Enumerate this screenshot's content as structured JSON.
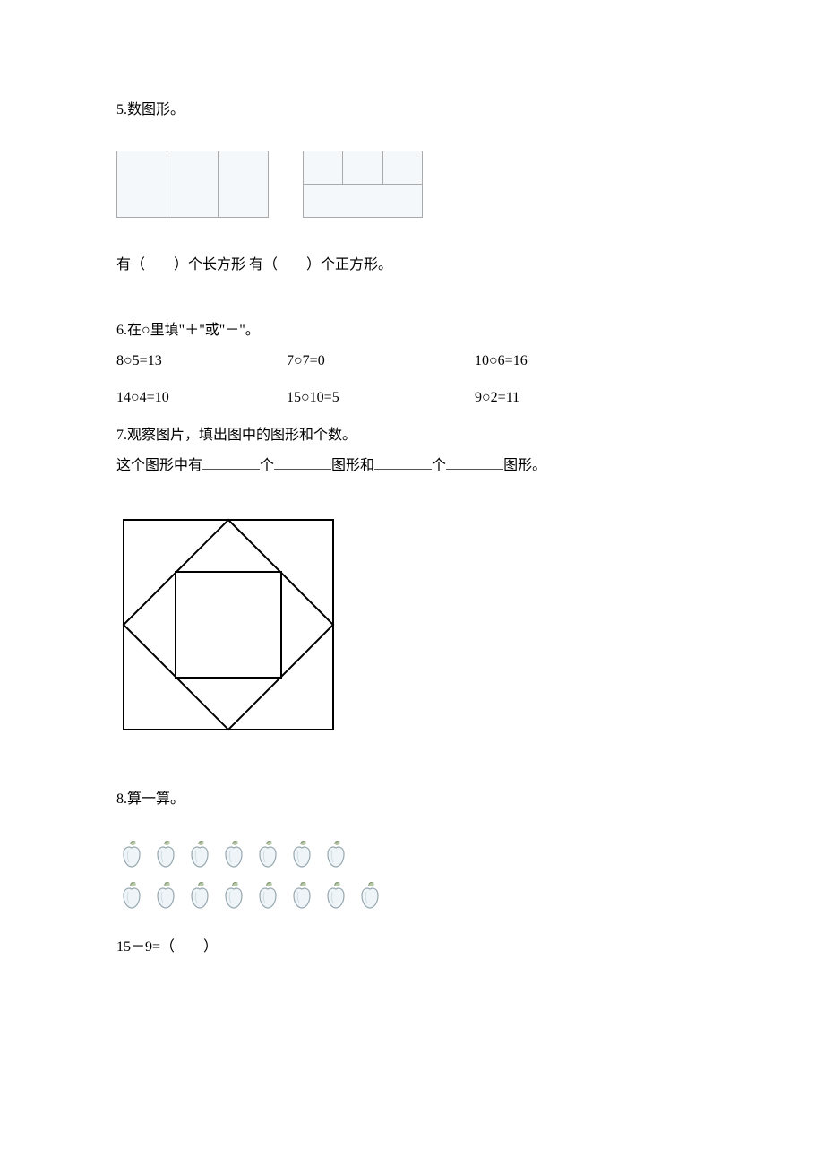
{
  "q5": {
    "title": "5.数图形。",
    "answer": "有（　　）个长方形 有（　　）个正方形。"
  },
  "q6": {
    "title": "6.在○里填\"＋\"或\"－\"。",
    "row1": {
      "a": "8○5=13",
      "b": "7○7=0",
      "c": "10○6=16"
    },
    "row2": {
      "a": "14○4=10",
      "b": "15○10=5",
      "c": "9○2=11"
    }
  },
  "q7": {
    "title": "7.观察图片，填出图中的图形和个数。",
    "fill_pre": "这个图形中有",
    "fill_ge1": "个",
    "fill_mid1": "图形和",
    "fill_ge2": "个",
    "fill_end": "图形。"
  },
  "q8": {
    "title": "8.算一算。",
    "row1_count": 7,
    "row2_count": 8,
    "eq": "15－9=（　　）"
  }
}
